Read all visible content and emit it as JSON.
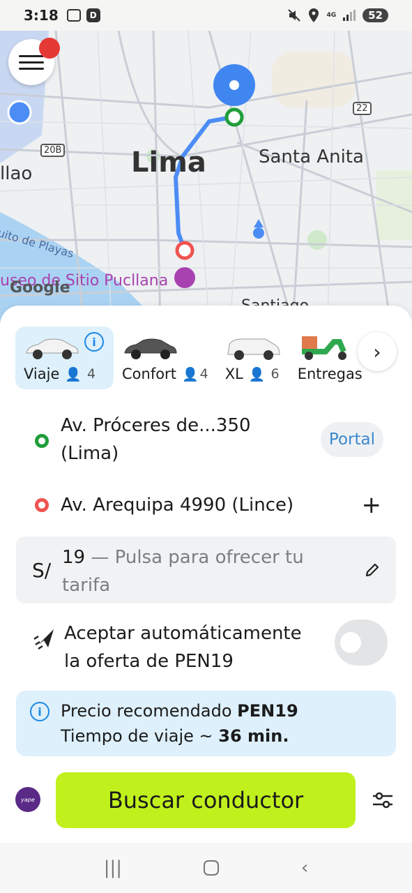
{
  "status_bar": {
    "time": "3:18",
    "battery": "52",
    "network": "4G"
  },
  "map": {
    "labels": {
      "city": "Lima",
      "district": "Santa Anita",
      "callao": "llao",
      "playas": "uito de Playas",
      "pucllana": "useo de Sitio Pucllana",
      "google": "Google",
      "santiago": "Santiago",
      "road_20b": "20B",
      "road_22": "22"
    },
    "route_color": "#4c8df5",
    "origin_color": "#1f9d3a",
    "destination_color": "#ef5350",
    "menu_icon": "hamburger-icon"
  },
  "tariffs": [
    {
      "label": "Viaje",
      "capacity": "4",
      "active": true
    },
    {
      "label": "Confort",
      "capacity": "4",
      "active": false
    },
    {
      "label": "XL",
      "capacity": "6",
      "active": false
    },
    {
      "label": "Entregas",
      "capacity": "",
      "active": false
    }
  ],
  "route": {
    "origin_line1": "Av. Próceres de...350",
    "origin_line2": "(Lima)",
    "portal": "Portal",
    "destination": "Av. Arequipa 4990 (Lince)"
  },
  "fare": {
    "currency": "S/",
    "value": "19",
    "placeholder_line1": " — Pulsa para ofrecer tu",
    "placeholder_line2": "tarifa"
  },
  "auto_accept": {
    "line1": "Aceptar automáticamente",
    "line2": "la oferta de PEN19",
    "enabled": false
  },
  "recommendation": {
    "price_label": "Precio recomendado ",
    "price_value": "PEN19",
    "time_label": "Tiempo de viaje ~ ",
    "time_value": "36 min."
  },
  "actions": {
    "search_button": "Buscar conductor",
    "payment_brand": "yape"
  },
  "accent_color": "#c1f11d"
}
